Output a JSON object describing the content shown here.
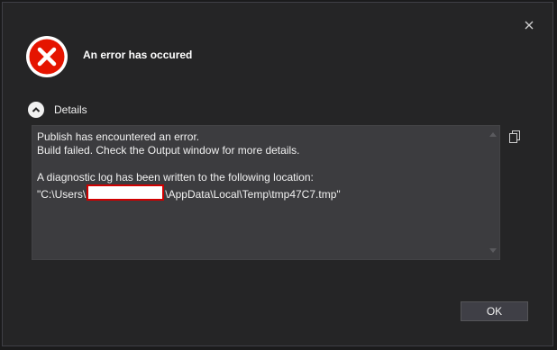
{
  "dialog": {
    "title": "An error has occured",
    "details_label": "Details",
    "ok_label": "OK",
    "icons": {
      "close": "close-icon",
      "error": "error-icon",
      "chevron": "chevron-up-icon",
      "copy": "copy-icon"
    },
    "colors": {
      "background": "#252526",
      "error_red": "#e51400",
      "redaction_border": "#d00000"
    },
    "message": {
      "line1": "Publish has encountered an error.",
      "line2": "Build failed. Check the Output window for more details.",
      "line3": "A diagnostic log has been written to the following location:",
      "path_prefix": "\"C:\\Users\\",
      "path_suffix": "\\AppData\\Local\\Temp\\tmp47C7.tmp\""
    }
  }
}
